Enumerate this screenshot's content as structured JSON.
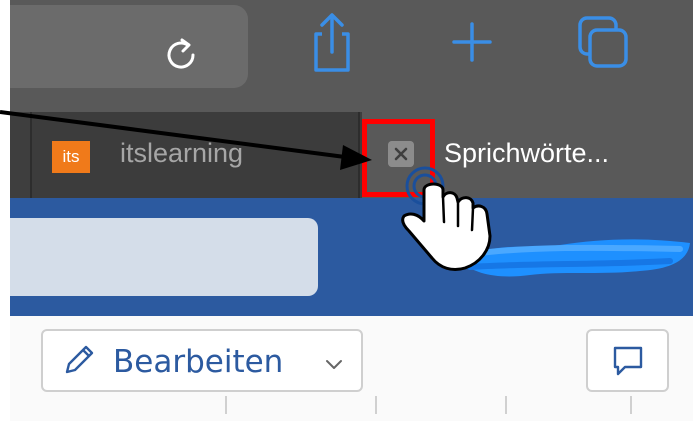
{
  "toolbar": {
    "icons": [
      "reload-icon",
      "share-icon",
      "new-tab-plus-icon",
      "tabs-overview-icon"
    ],
    "accent": "#3a8ee6",
    "background": "#595959"
  },
  "tabs": [
    {
      "favicon_text": "its",
      "label": "itslearning",
      "active": false
    },
    {
      "label": "Sprichwörte...",
      "active": true
    }
  ],
  "header": {
    "background": "#2c5aa0"
  },
  "commandbar": {
    "edit_label": "Bearbeiten",
    "edit_icon": "pencil-icon",
    "dropdown_icon": "chevron-down-icon",
    "comment_icon": "comment-icon"
  },
  "annotation": {
    "highlight_color": "#ff0000",
    "pointer": "hand-cursor-icon",
    "arrow": "arrow-icon"
  }
}
